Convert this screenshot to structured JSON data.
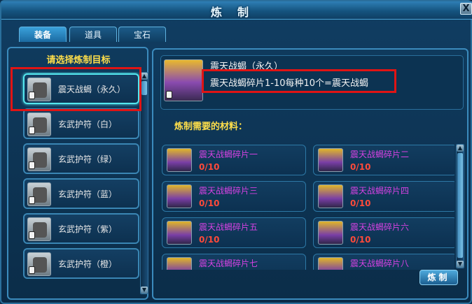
{
  "window": {
    "title": "炼制",
    "close_label": "X"
  },
  "tabs": [
    {
      "label": "装备",
      "active": true
    },
    {
      "label": "道具",
      "active": false
    },
    {
      "label": "宝石",
      "active": false
    }
  ],
  "left_panel": {
    "heading": "请选择炼制目标",
    "items": [
      {
        "name": "震天战蝎（永久）",
        "selected": true
      },
      {
        "name": "玄武护符（白）",
        "selected": false
      },
      {
        "name": "玄武护符（绿）",
        "selected": false
      },
      {
        "name": "玄武护符（蓝）",
        "selected": false
      },
      {
        "name": "玄武护符（紫）",
        "selected": false
      },
      {
        "name": "玄武护符（橙）",
        "selected": false
      }
    ]
  },
  "target": {
    "name": "震天战蝎（永久）",
    "description": "震天战蝎碎片1-10每种10个=震天战蝎"
  },
  "materials": {
    "heading": "炼制需要的材料：",
    "items": [
      {
        "name": "震天战蝎碎片一",
        "count": "0/10"
      },
      {
        "name": "震天战蝎碎片二",
        "count": "0/10"
      },
      {
        "name": "震天战蝎碎片三",
        "count": "0/10"
      },
      {
        "name": "震天战蝎碎片四",
        "count": "0/10"
      },
      {
        "name": "震天战蝎碎片五",
        "count": "0/10"
      },
      {
        "name": "震天战蝎碎片六",
        "count": "0/10"
      },
      {
        "name": "震天战蝎碎片七",
        "count": ""
      },
      {
        "name": "震天战蝎碎片八",
        "count": ""
      }
    ]
  },
  "refine_button": "炼制",
  "colors": {
    "heading": "#ffdf4a",
    "material_name": "#d542e2",
    "material_count": "#ff4a3a",
    "highlight": "#e01414"
  },
  "icons": {
    "close": "close-icon",
    "scroll_up": "arrow-up-icon",
    "scroll_down": "arrow-down-icon",
    "lock": "lock-icon"
  }
}
